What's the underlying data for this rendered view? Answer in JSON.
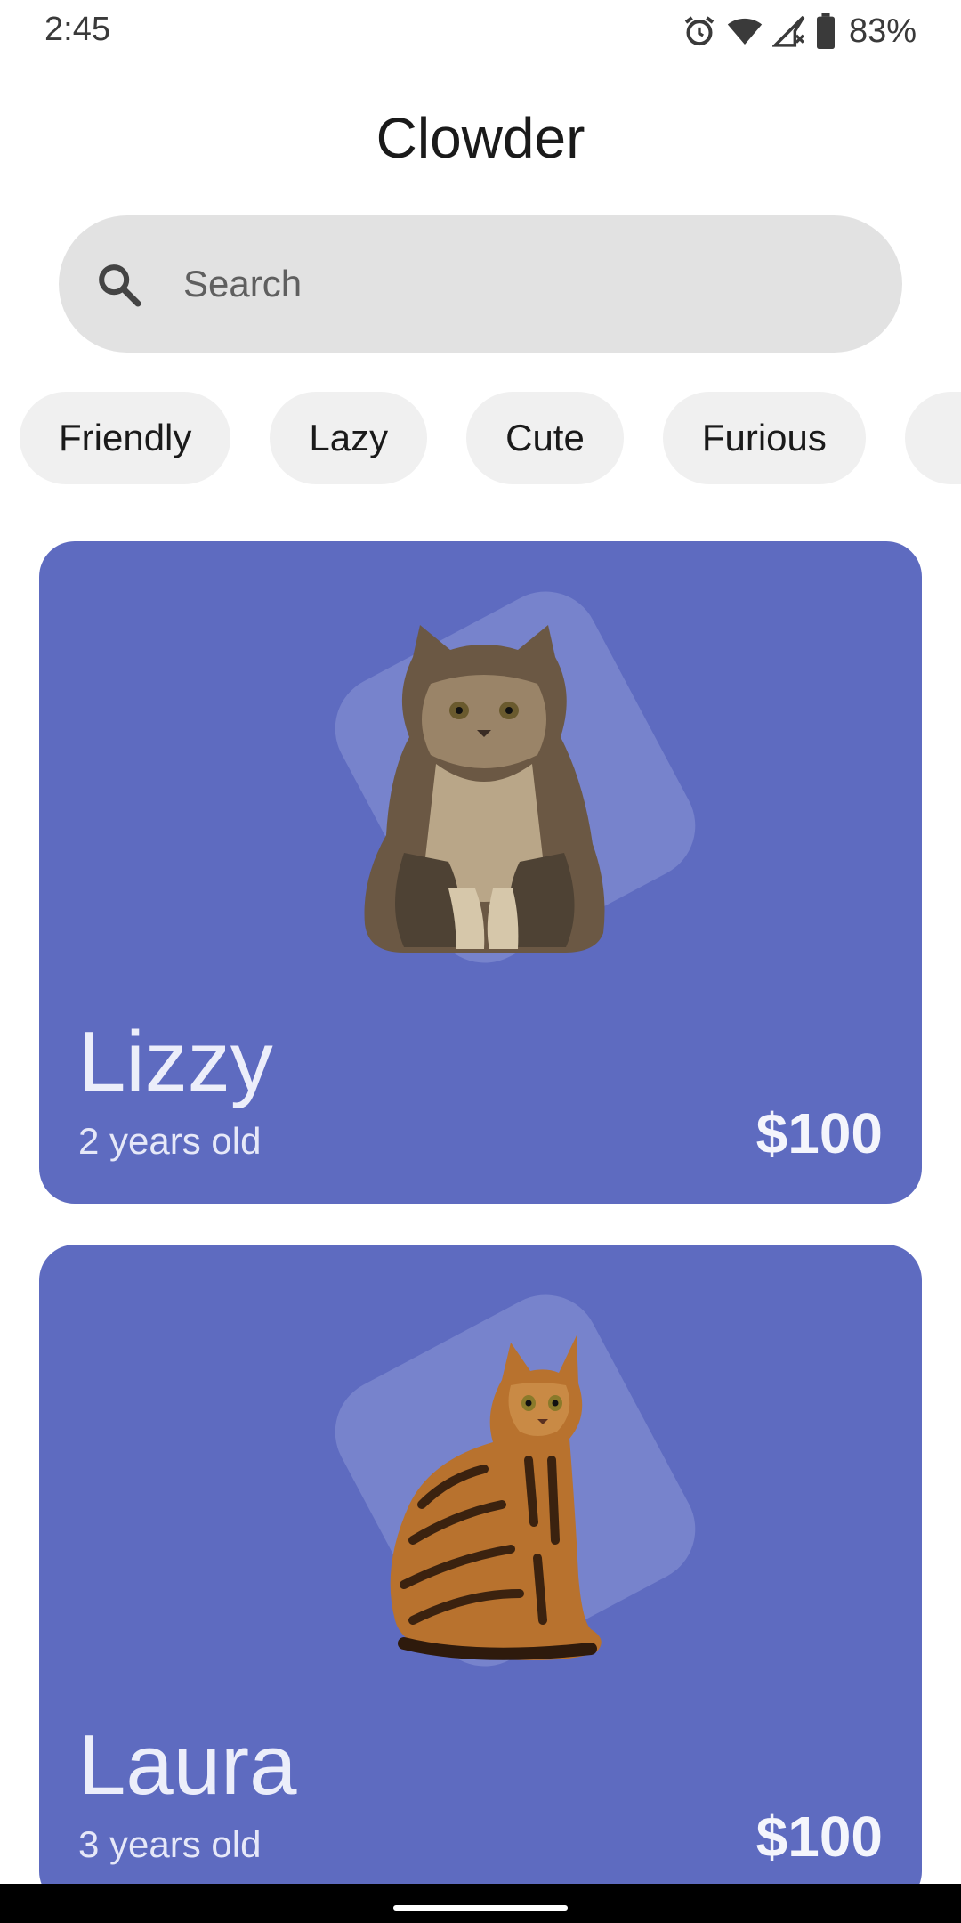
{
  "status_bar": {
    "time": "2:45",
    "battery_percent": "83%",
    "icons": [
      "alarm-icon",
      "wifi-icon",
      "signal-icon",
      "battery-icon"
    ]
  },
  "header": {
    "title": "Clowder"
  },
  "search": {
    "placeholder": "Search",
    "value": "",
    "icon": "search-icon"
  },
  "filters": {
    "chips": [
      "Friendly",
      "Lazy",
      "Cute",
      "Furious"
    ]
  },
  "cats": [
    {
      "name": "Lizzy",
      "age": "2 years old",
      "price": "$100",
      "image": "persian-cat-photo"
    },
    {
      "name": "Laura",
      "age": "3 years old",
      "price": "$100",
      "image": "bengal-cat-photo"
    }
  ],
  "colors": {
    "card_background": "#5e6bc0",
    "card_backdrop": "#7783cc",
    "search_background": "#e2e2e2",
    "chip_background": "#f0f0f0"
  }
}
